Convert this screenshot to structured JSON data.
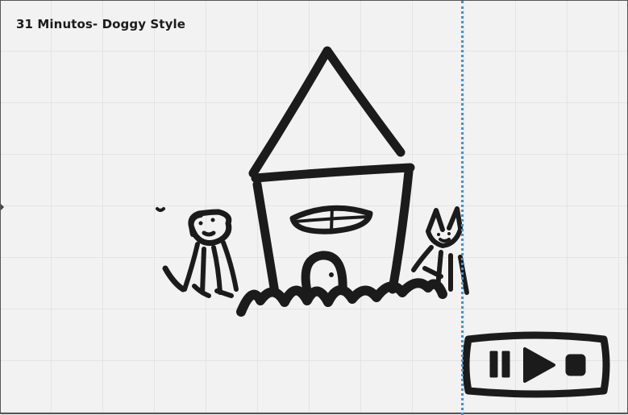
{
  "frame": {
    "title": "31 Minutos- Doggy Style"
  },
  "drawing": {
    "subjects": [
      "house",
      "dog",
      "cat",
      "grass",
      "media-controls"
    ],
    "ink_color": "#1b1b1b"
  },
  "colors": {
    "canvas_background": "#f2f2f2",
    "grid_line": "#e4e4e4",
    "guide_line": "#3a95dd",
    "frame_border": "#555555"
  },
  "icons": [
    "pause-icon",
    "play-icon",
    "stop-icon"
  ]
}
